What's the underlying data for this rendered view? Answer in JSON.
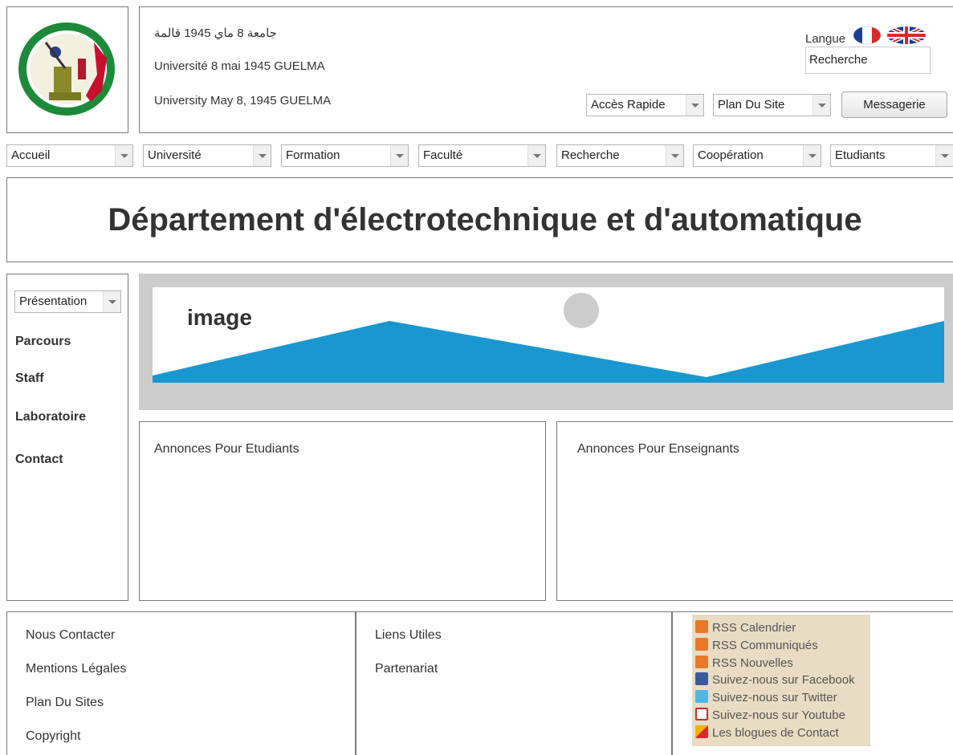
{
  "header": {
    "arabic_name": "جامعة 8 ماي 1945 قالمة",
    "french_name": "Université 8 mai 1945 GUELMA",
    "english_name": "University May 8, 1945 GUELMA",
    "langue_label": "Langue",
    "search_value": "Recherche",
    "acces_rapide": "Accès Rapide",
    "plan_du_site": "Plan Du Site",
    "messagerie": "Messagerie"
  },
  "nav": {
    "items": [
      "Accueil",
      "Université",
      "Formation",
      "Faculté",
      "Recherche",
      "Coopération",
      "Etudiants"
    ]
  },
  "page_title": "Département d'électrotechnique et d'automatique",
  "sidebar": {
    "presentation": "Présentation",
    "links": [
      "Parcours",
      "Staff",
      "Laboratoire",
      "Contact"
    ]
  },
  "banner": {
    "label": "image"
  },
  "panels": {
    "etudiants": "Annonces Pour Etudiants",
    "enseignants": "Annonces Pour Enseignants"
  },
  "footer": {
    "col1": [
      "Nous Contacter",
      "Mentions Légales",
      "Plan Du Sites",
      "Copyright"
    ],
    "col2": [
      "Liens Utiles",
      "Partenariat"
    ],
    "rss": [
      "RSS Calendrier",
      "RSS Communiqués",
      "RSS Nouvelles",
      "Suivez-nous sur Facebook",
      "Suivez-nous sur Twitter",
      "Suivez-nous sur Youtube",
      "Les blogues de Contact"
    ]
  },
  "colors": {
    "banner_blue": "#1a97d0",
    "banner_gray": "#cccccc",
    "rss_bg": "#e8dcc4",
    "rss_orange": "#e8782a"
  },
  "icons": [
    "university-logo",
    "france-flag-icon",
    "uk-flag-icon",
    "rss-icon",
    "facebook-icon",
    "twitter-icon",
    "youtube-icon",
    "blog-icon",
    "image-placeholder-icon"
  ]
}
